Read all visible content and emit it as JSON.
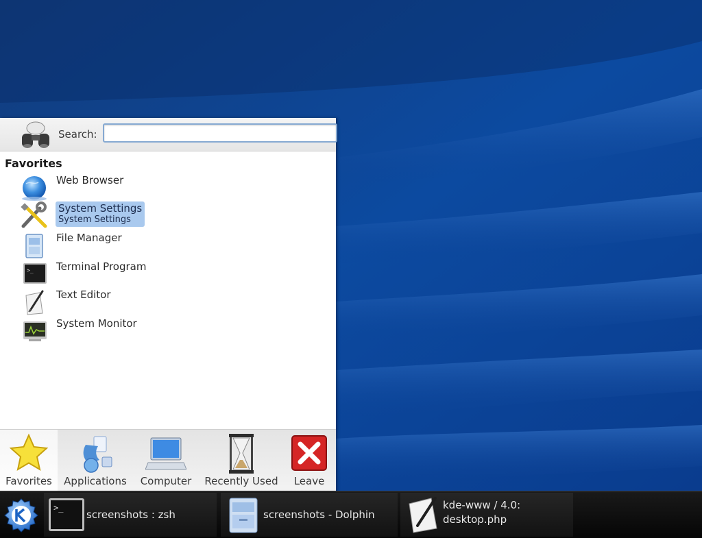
{
  "launcher": {
    "search": {
      "label": "Search:",
      "value": "",
      "placeholder": ""
    },
    "favorites_heading": "Favorites",
    "favorites": [
      {
        "label": "Web Browser",
        "icon": "globe-icon"
      },
      {
        "label": "System Settings",
        "sublabel": "System Settings",
        "icon": "system-settings-icon",
        "selected": true
      },
      {
        "label": "File Manager",
        "icon": "file-manager-icon"
      },
      {
        "label": "Terminal Program",
        "icon": "terminal-icon"
      },
      {
        "label": "Text Editor",
        "icon": "text-editor-icon"
      },
      {
        "label": "System Monitor",
        "icon": "system-monitor-icon"
      }
    ],
    "tabs": [
      {
        "label": "Favorites",
        "icon": "star-icon",
        "active": true
      },
      {
        "label": "Applications",
        "icon": "applications-icon"
      },
      {
        "label": "Computer",
        "icon": "computer-icon"
      },
      {
        "label": "Recently Used",
        "icon": "hourglass-icon"
      },
      {
        "label": "Leave",
        "icon": "leave-icon"
      }
    ]
  },
  "taskbar": {
    "kde_button_icon": "kde-logo-icon",
    "tasks": [
      {
        "label": "screenshots : zsh",
        "icon": "terminal-icon"
      },
      {
        "label": "screenshots - Dolphin",
        "icon": "folder-icon"
      },
      {
        "label_line1": "kde-www / 4.0:",
        "label_line2": "desktop.php",
        "icon": "text-editor-icon"
      }
    ]
  },
  "colors": {
    "wallpaper": "#0d3a86",
    "selection": "#a9c9ee",
    "taskbar": "#0f0f0f"
  }
}
